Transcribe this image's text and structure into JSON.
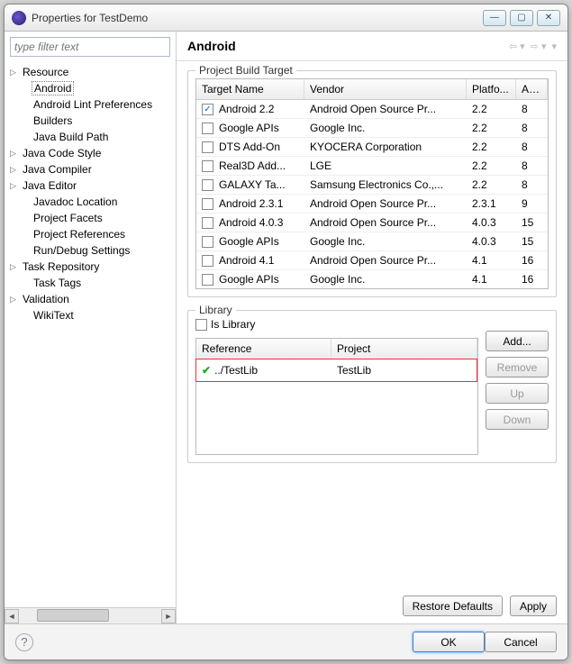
{
  "window": {
    "title": "Properties for TestDemo"
  },
  "filter": {
    "placeholder": "type filter text"
  },
  "tree": [
    {
      "label": "Resource",
      "expandable": true,
      "level": 0
    },
    {
      "label": "Android",
      "expandable": false,
      "level": 1,
      "selected": true
    },
    {
      "label": "Android Lint Preferences",
      "expandable": false,
      "level": 1
    },
    {
      "label": "Builders",
      "expandable": false,
      "level": 1
    },
    {
      "label": "Java Build Path",
      "expandable": false,
      "level": 1
    },
    {
      "label": "Java Code Style",
      "expandable": true,
      "level": 0
    },
    {
      "label": "Java Compiler",
      "expandable": true,
      "level": 0
    },
    {
      "label": "Java Editor",
      "expandable": true,
      "level": 0
    },
    {
      "label": "Javadoc Location",
      "expandable": false,
      "level": 1
    },
    {
      "label": "Project Facets",
      "expandable": false,
      "level": 1
    },
    {
      "label": "Project References",
      "expandable": false,
      "level": 1
    },
    {
      "label": "Run/Debug Settings",
      "expandable": false,
      "level": 1
    },
    {
      "label": "Task Repository",
      "expandable": true,
      "level": 0
    },
    {
      "label": "Task Tags",
      "expandable": false,
      "level": 1
    },
    {
      "label": "Validation",
      "expandable": true,
      "level": 0
    },
    {
      "label": "WikiText",
      "expandable": false,
      "level": 1
    }
  ],
  "main": {
    "heading": "Android",
    "build_group": "Project Build Target",
    "columns": {
      "name": "Target Name",
      "vendor": "Vendor",
      "platform": "Platfo...",
      "api": "AP..."
    },
    "targets": [
      {
        "name": "Android 2.2",
        "vendor": "Android Open Source Pr...",
        "platform": "2.2",
        "api": "8",
        "checked": true
      },
      {
        "name": "Google APIs",
        "vendor": "Google Inc.",
        "platform": "2.2",
        "api": "8",
        "checked": false
      },
      {
        "name": "DTS Add-On",
        "vendor": "KYOCERA Corporation",
        "platform": "2.2",
        "api": "8",
        "checked": false
      },
      {
        "name": "Real3D Add...",
        "vendor": "LGE",
        "platform": "2.2",
        "api": "8",
        "checked": false
      },
      {
        "name": "GALAXY Ta...",
        "vendor": "Samsung Electronics Co.,...",
        "platform": "2.2",
        "api": "8",
        "checked": false
      },
      {
        "name": "Android 2.3.1",
        "vendor": "Android Open Source Pr...",
        "platform": "2.3.1",
        "api": "9",
        "checked": false
      },
      {
        "name": "Android 4.0.3",
        "vendor": "Android Open Source Pr...",
        "platform": "4.0.3",
        "api": "15",
        "checked": false
      },
      {
        "name": "Google APIs",
        "vendor": "Google Inc.",
        "platform": "4.0.3",
        "api": "15",
        "checked": false
      },
      {
        "name": "Android 4.1",
        "vendor": "Android Open Source Pr...",
        "platform": "4.1",
        "api": "16",
        "checked": false
      },
      {
        "name": "Google APIs",
        "vendor": "Google Inc.",
        "platform": "4.1",
        "api": "16",
        "checked": false
      }
    ],
    "library": {
      "group": "Library",
      "is_library": "Is Library",
      "cols": {
        "ref": "Reference",
        "proj": "Project"
      },
      "rows": [
        {
          "ref": "../TestLib",
          "proj": "TestLib"
        }
      ],
      "buttons": {
        "add": "Add...",
        "remove": "Remove",
        "up": "Up",
        "down": "Down"
      }
    },
    "restore": "Restore Defaults",
    "apply": "Apply"
  },
  "footer": {
    "ok": "OK",
    "cancel": "Cancel"
  }
}
